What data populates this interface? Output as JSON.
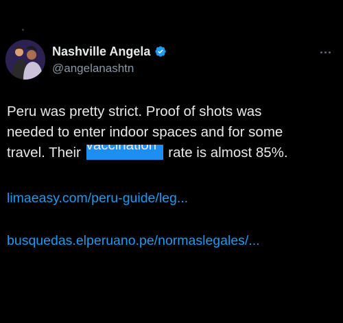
{
  "tweet": {
    "author": {
      "display_name": "Nashville Angela",
      "handle": "@angelanashtn",
      "verified_icon": "verified-badge-icon",
      "verified_color": "#1d9bf0"
    },
    "body": {
      "line1": "Peru was pretty strict. Proof of shots was",
      "line2": "needed to enter indoor spaces and for some",
      "line3_before": "travel. Their",
      "line3_redacted_peek": "vaccination",
      "line3_after": "rate is almost 85%."
    },
    "links": [
      {
        "text": "limaeasy.com/peru-guide/leg..."
      },
      {
        "text": "busquedas.elperuano.pe/normaslegales/..."
      }
    ],
    "more_menu_icon": "more-horizontal-icon"
  },
  "colors": {
    "background": "#000000",
    "text_primary": "#e7e9ea",
    "text_secondary": "#8b98a5",
    "link": "#1d9bf0",
    "redaction_box": "#1d8ff2"
  }
}
